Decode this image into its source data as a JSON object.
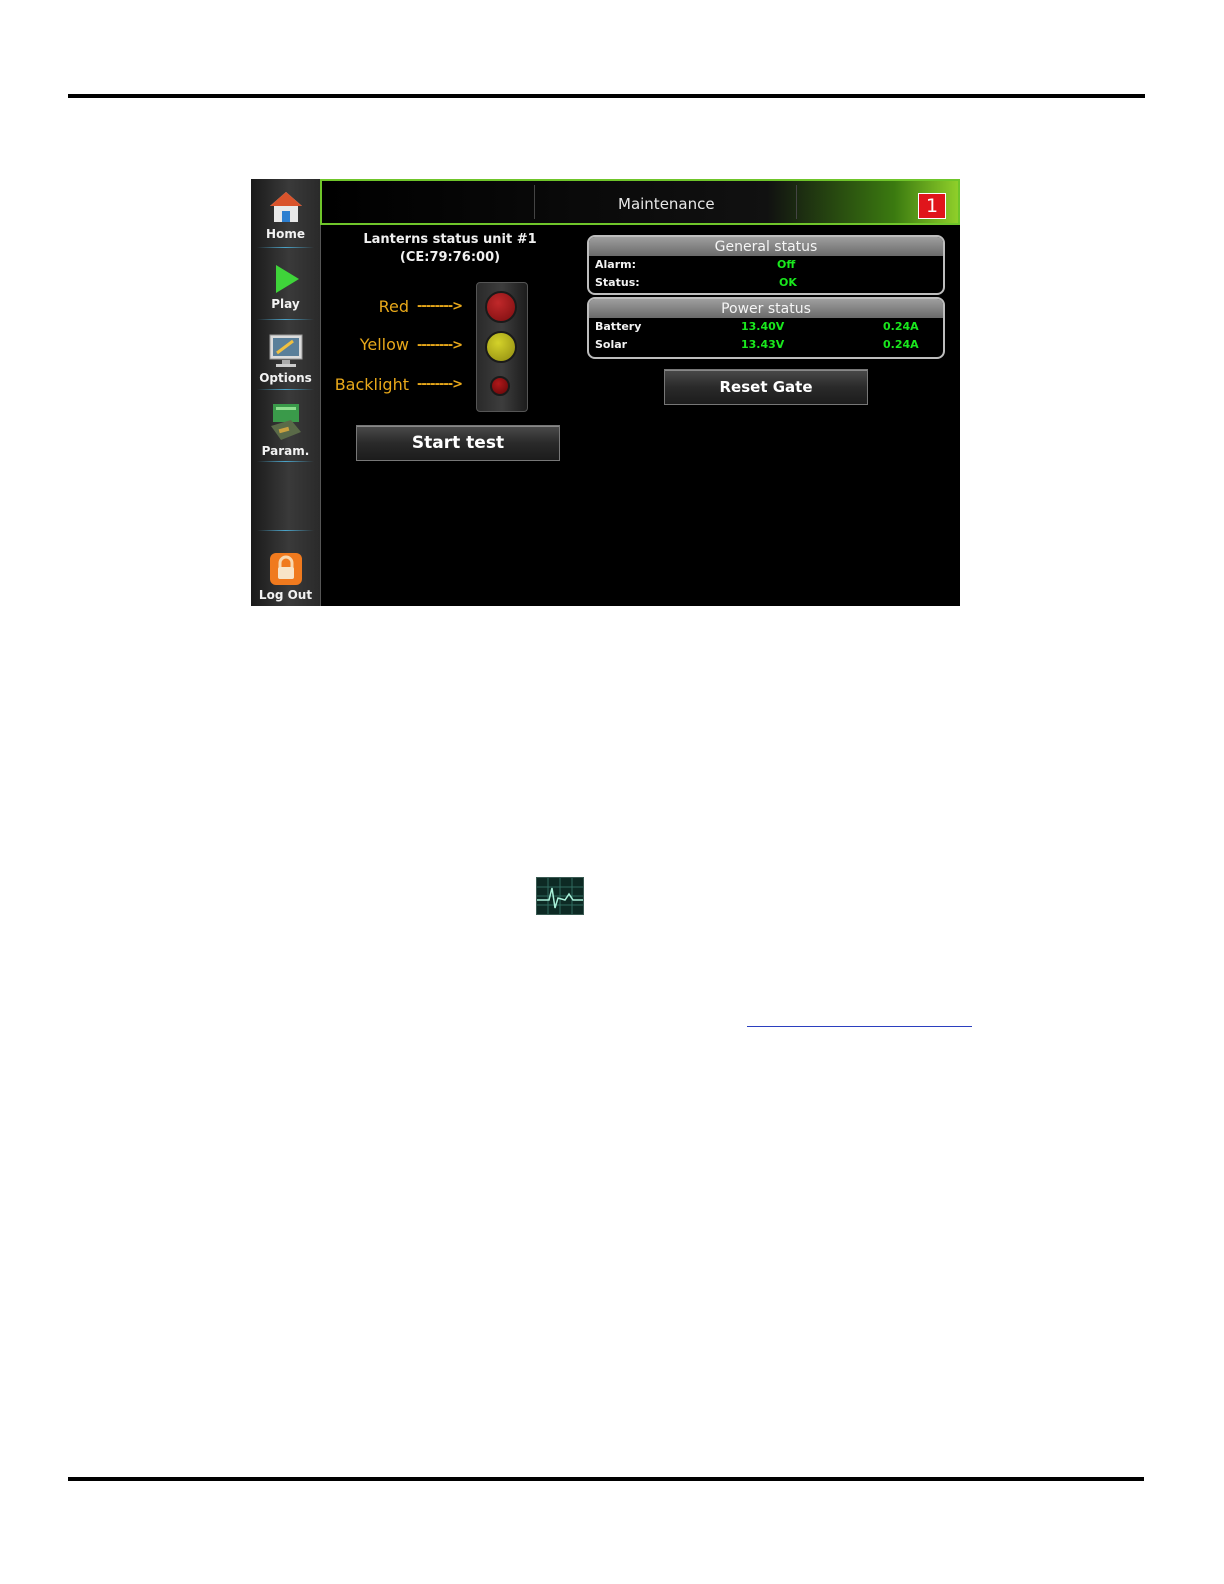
{
  "colors": {
    "accent_green": "#6fc52a",
    "value_green": "#19e81d",
    "label_orange": "#e8a81a",
    "badge_red": "#e0151b"
  },
  "sidebar": {
    "items": [
      {
        "label": "Home",
        "icon": "home-icon"
      },
      {
        "label": "Play",
        "icon": "play-icon"
      },
      {
        "label": "Options",
        "icon": "options-icon"
      },
      {
        "label": "Param.",
        "icon": "param-icon"
      },
      {
        "label": "Log Out",
        "icon": "lock-icon"
      }
    ]
  },
  "header": {
    "title": "Maintenance",
    "badge": "1"
  },
  "lanterns": {
    "title_line1": "Lanterns status unit #1",
    "title_line2": "(CE:79:76:00)",
    "labels": {
      "red": "Red",
      "yellow": "Yellow",
      "backlight": "Backlight"
    },
    "arrow": "-------->",
    "start_button": "Start test"
  },
  "general_status": {
    "title": "General status",
    "alarm_label": "Alarm:",
    "alarm_value": "Off",
    "status_label": "Status:",
    "status_value": "OK"
  },
  "power_status": {
    "title": "Power status",
    "battery_label": "Battery",
    "battery_voltage": "13.40V",
    "battery_current": "0.24A",
    "solar_label": "Solar",
    "solar_voltage": "13.43V",
    "solar_current": "0.24A"
  },
  "reset_button": "Reset Gate"
}
